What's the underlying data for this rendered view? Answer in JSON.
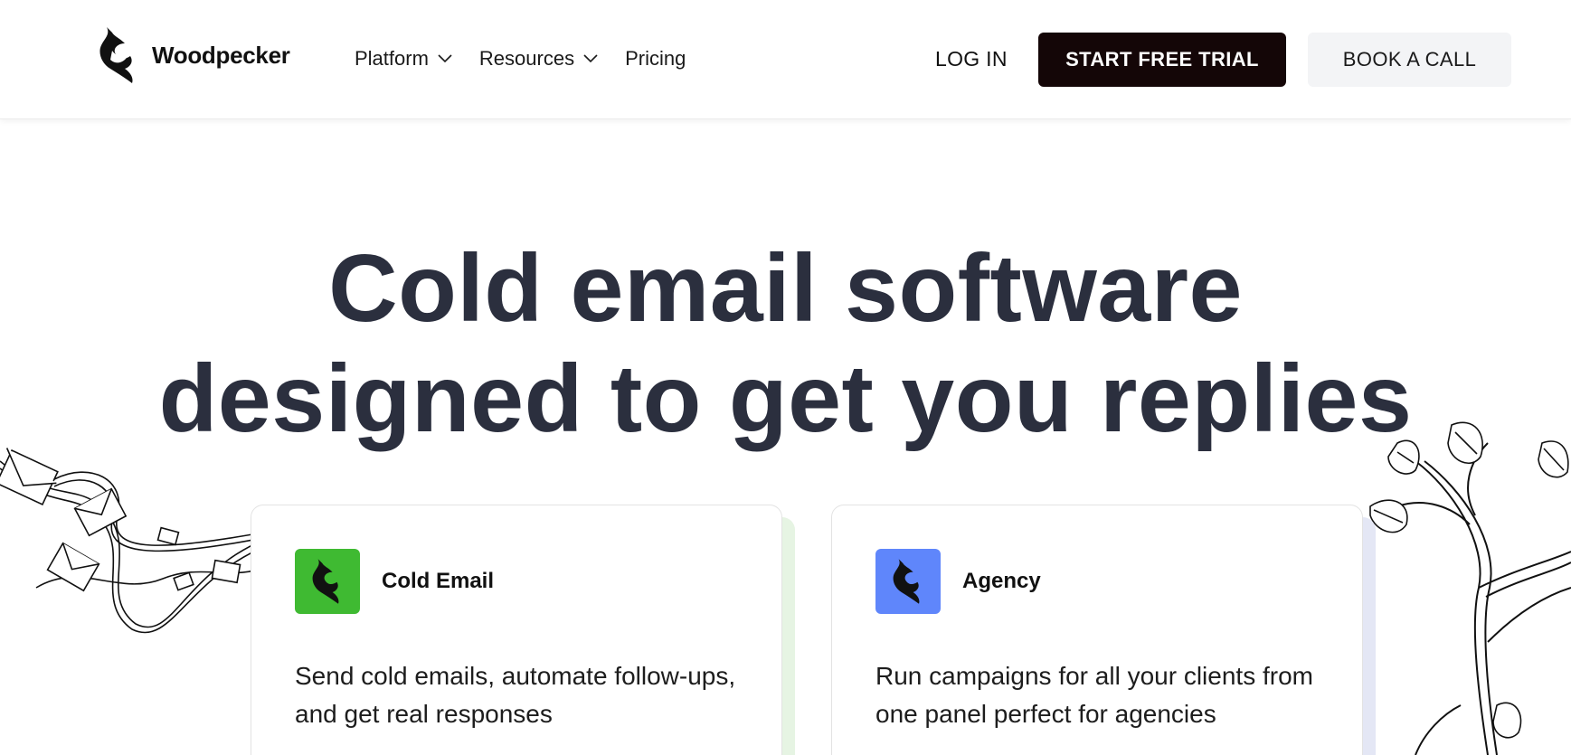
{
  "brand": {
    "name": "Woodpecker"
  },
  "nav": {
    "items": [
      {
        "label": "Platform",
        "has_dropdown": true
      },
      {
        "label": "Resources",
        "has_dropdown": true
      },
      {
        "label": "Pricing",
        "has_dropdown": false
      }
    ]
  },
  "header_actions": {
    "login_label": "LOG IN",
    "trial_label": "START FREE TRIAL",
    "call_label": "BOOK A CALL"
  },
  "hero": {
    "title_line1": "Cold email software",
    "title_line2": "designed to get you replies"
  },
  "cards": [
    {
      "title": "Cold Email",
      "description": "Send cold emails, automate follow-ups, and get real responses",
      "icon": "woodpecker-logo-icon",
      "icon_bg": "#3fba32",
      "shadow_color": "#e6f4e3"
    },
    {
      "title": "Agency",
      "description": "Run campaigns for all your clients from one panel perfect for agencies",
      "icon": "woodpecker-logo-icon",
      "icon_bg": "#5f86fb",
      "shadow_color": "#e4e7f5"
    }
  ],
  "colors": {
    "primary_button": "#140607",
    "secondary_button": "#f3f4f6",
    "heading": "#2b2f3e"
  }
}
